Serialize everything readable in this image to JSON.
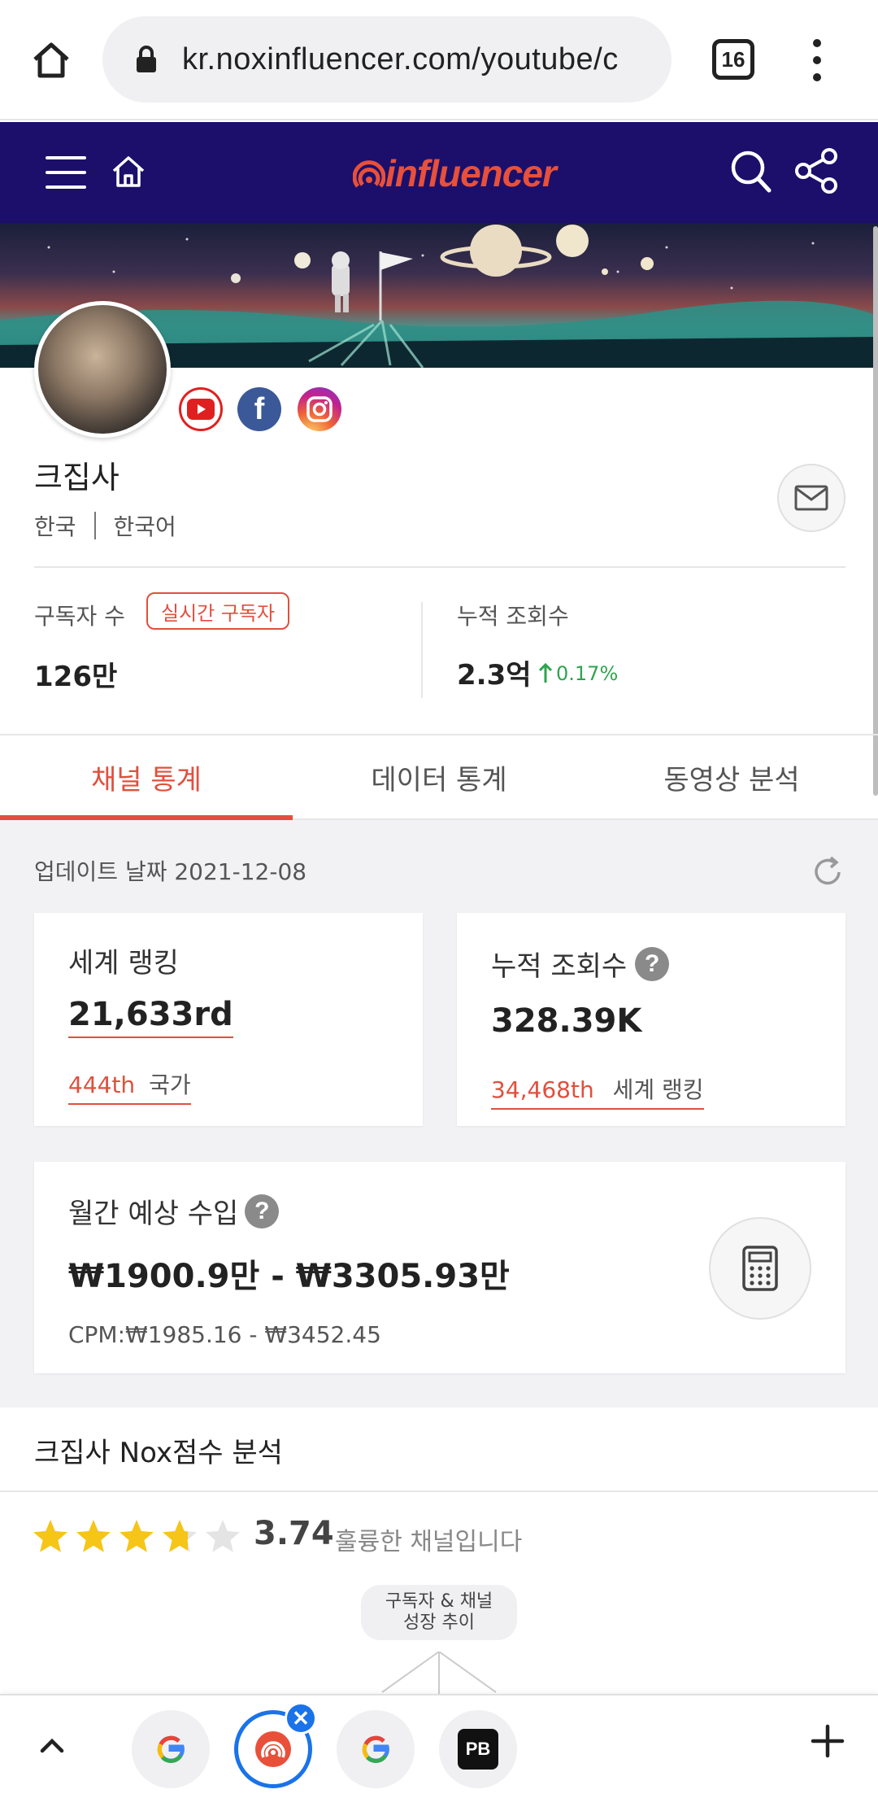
{
  "browser": {
    "url": "kr.noxinfluencer.com/youtube/c",
    "tab_count": "16"
  },
  "site": {
    "logo_text": "influencer"
  },
  "channel": {
    "name": "크집사",
    "country": "한국",
    "language": "한국어"
  },
  "stats": {
    "subscribers_label": "구독자 수",
    "realtime_badge": "실시간 구독자",
    "subscribers_value": "126만",
    "views_label": "누적 조회수",
    "views_value": "2.3억",
    "views_growth": "0.17%"
  },
  "tabs": [
    {
      "label": "채널 통계",
      "active": true
    },
    {
      "label": "데이터 통계",
      "active": false
    },
    {
      "label": "동영상 분석",
      "active": false
    }
  ],
  "update": {
    "text": "업데이트 날짜 2021-12-08"
  },
  "cards": {
    "world_rank": {
      "title": "세계 랭킹",
      "value": "21,633rd",
      "sub_rank": "444th",
      "sub_label": "국가"
    },
    "avg_views": {
      "title": "누적 조회수",
      "value": "328.39K",
      "sub_rank": "34,468th",
      "sub_label": "세계 랭킹"
    },
    "income": {
      "title": "월간 예상 수입",
      "value": "₩1900.9만 - ₩3305.93만",
      "cpm": "CPM:₩1985.16 - ₩3452.45"
    }
  },
  "nox": {
    "title": "크집사 Nox점수 분석",
    "score": "3.74",
    "rating_fraction": 0.748,
    "description": "훌륭한 채널입니다",
    "bubble_line1": "구독자 & 채널",
    "bubble_line2": "성장 추이"
  },
  "colors": {
    "brand_navy": "#1b0f6b",
    "accent_red": "#e0503e",
    "growth_green": "#2ea44f",
    "star_gold": "#f5c518",
    "tab_blue": "#1a73e8"
  }
}
